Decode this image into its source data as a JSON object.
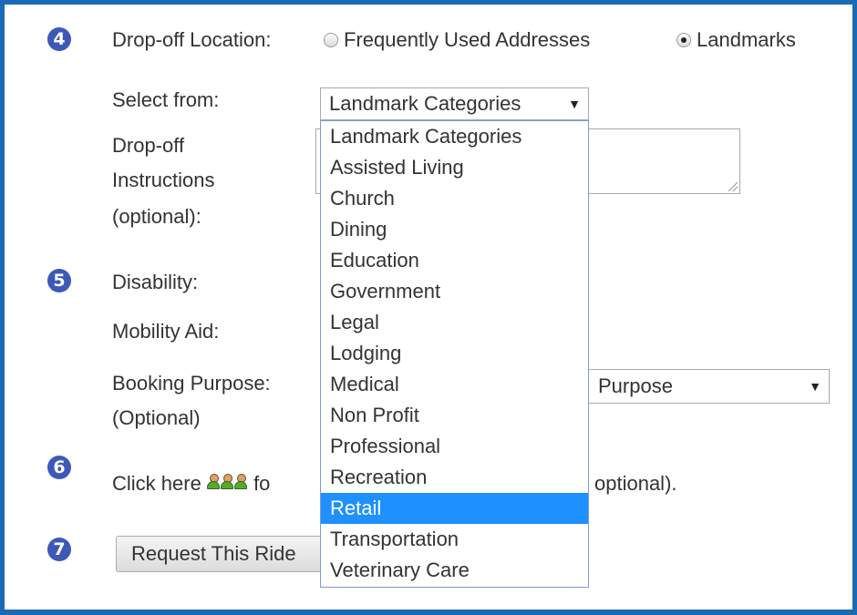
{
  "steps": {
    "s4": "4",
    "s5": "5",
    "s6": "6",
    "s7": "7"
  },
  "dropoff": {
    "label": "Drop-off Location:",
    "radio_frequent": "Frequently Used Addresses",
    "radio_landmarks": "Landmarks",
    "selected_radio": "Landmarks",
    "select_from_label": "Select from:",
    "select_value": "Landmark Categories",
    "instructions_label_1": "Drop-off",
    "instructions_label_2": "Instructions",
    "instructions_label_3": "(optional):"
  },
  "dropdown": {
    "options": [
      "Landmark Categories",
      "Assisted Living",
      "Church",
      "Dining",
      "Education",
      "Government",
      "Legal",
      "Lodging",
      "Medical",
      "Non Profit",
      "Professional",
      "Recreation",
      "Retail",
      "Transportation",
      "Veterinary Care"
    ],
    "highlighted": "Retail"
  },
  "disability": {
    "label": "Disability:"
  },
  "mobility": {
    "label": "Mobility Aid:"
  },
  "booking": {
    "label_1": "Booking Purpose:",
    "label_2": "(Optional)",
    "select_value": "Purpose"
  },
  "companions": {
    "text_start": "Click here",
    "text_mid": "fo",
    "text_end": "optional)."
  },
  "request": {
    "button_label": "Request This Ride"
  },
  "colors": {
    "frame": "#1a6ab5",
    "step_badge": "#3d59b8",
    "highlight": "#1e90ff"
  }
}
